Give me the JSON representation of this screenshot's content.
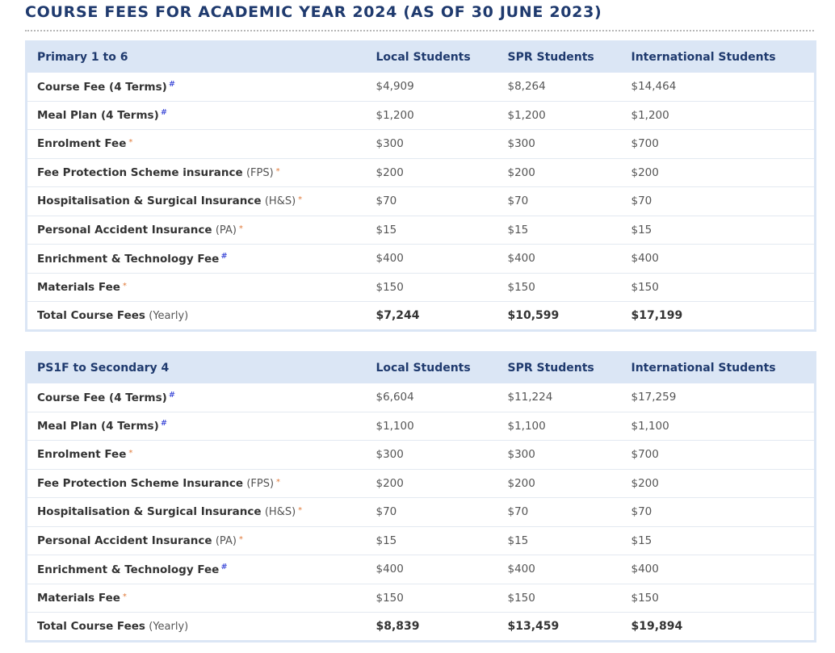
{
  "page": {
    "title": "COURSE FEES FOR ACADEMIC YEAR 2024 (AS OF 30 JUNE 2023)"
  },
  "primary": {
    "headers": [
      "Primary 1 to 6",
      "Local Students",
      "SPR Students",
      "International Students"
    ],
    "rows": [
      {
        "name": "Course Fee (4 Terms)",
        "suffix": "",
        "mark": "#",
        "local": "$4,909",
        "spr": "$8,264",
        "intl": "$14,464"
      },
      {
        "name": "Meal Plan (4 Terms)",
        "suffix": "",
        "mark": "#",
        "local": "$1,200",
        "spr": "$1,200",
        "intl": "$1,200"
      },
      {
        "name": "Enrolment Fee",
        "suffix": "",
        "mark": "*",
        "local": "$300",
        "spr": "$300",
        "intl": "$700"
      },
      {
        "name": "Fee Protection Scheme insurance",
        "suffix": "(FPS)",
        "mark": "*",
        "local": "$200",
        "spr": "$200",
        "intl": "$200"
      },
      {
        "name": "Hospitalisation & Surgical Insurance",
        "suffix": "(H&S)",
        "mark": "*",
        "local": "$70",
        "spr": "$70",
        "intl": "$70"
      },
      {
        "name": "Personal Accident Insurance",
        "suffix": "(PA)",
        "mark": "*",
        "local": "$15",
        "spr": "$15",
        "intl": "$15"
      },
      {
        "name": "Enrichment & Technology Fee",
        "suffix": "",
        "mark": "#",
        "local": "$400",
        "spr": "$400",
        "intl": "$400"
      },
      {
        "name": "Materials Fee",
        "suffix": "",
        "mark": "*",
        "local": "$150",
        "spr": "$150",
        "intl": "$150"
      }
    ],
    "total": {
      "name": "Total Course Fees",
      "suffix": "(Yearly)",
      "local": "$7,244",
      "spr": "$10,599",
      "intl": "$17,199"
    }
  },
  "secondary": {
    "headers": [
      "PS1F to Secondary 4",
      "Local Students",
      "SPR Students",
      "International Students"
    ],
    "rows": [
      {
        "name": "Course Fee (4 Terms)",
        "suffix": "",
        "mark": "#",
        "local": "$6,604",
        "spr": "$11,224",
        "intl": "$17,259"
      },
      {
        "name": "Meal Plan (4 Terms)",
        "suffix": "",
        "mark": "#",
        "local": "$1,100",
        "spr": "$1,100",
        "intl": "$1,100"
      },
      {
        "name": "Enrolment Fee",
        "suffix": "",
        "mark": "*",
        "local": "$300",
        "spr": "$300",
        "intl": "$700"
      },
      {
        "name": "Fee Protection Scheme Insurance",
        "suffix": "(FPS)",
        "mark": "*",
        "local": "$200",
        "spr": "$200",
        "intl": "$200"
      },
      {
        "name": "Hospitalisation & Surgical Insurance",
        "suffix": "(H&S)",
        "mark": "*",
        "local": "$70",
        "spr": "$70",
        "intl": "$70"
      },
      {
        "name": "Personal Accident Insurance",
        "suffix": "(PA)",
        "mark": "*",
        "local": "$15",
        "spr": "$15",
        "intl": "$15"
      },
      {
        "name": "Enrichment & Technology Fee",
        "suffix": "",
        "mark": "#",
        "local": "$400",
        "spr": "$400",
        "intl": "$400"
      },
      {
        "name": "Materials Fee",
        "suffix": "",
        "mark": "*",
        "local": "$150",
        "spr": "$150",
        "intl": "$150"
      }
    ],
    "total": {
      "name": "Total Course Fees",
      "suffix": "(Yearly)",
      "local": "$8,839",
      "spr": "$13,459",
      "intl": "$19,894"
    }
  },
  "colors": {
    "title": "#1f3a6e",
    "header_bg": "#dbe6f5",
    "hash_mark": "#1d2bd1",
    "star_mark": "#e07a3a"
  }
}
